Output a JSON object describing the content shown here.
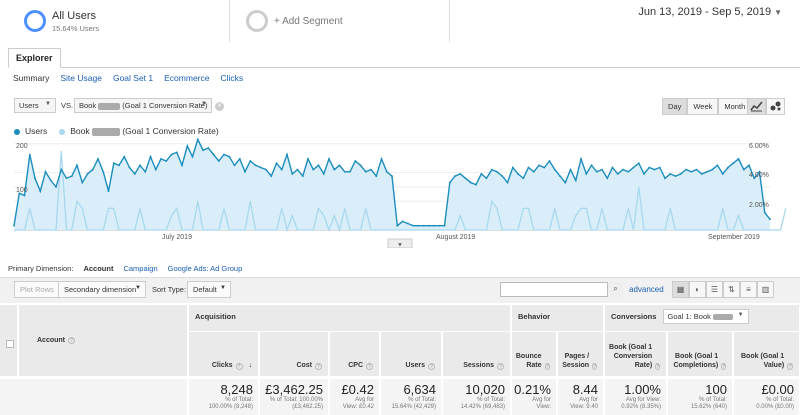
{
  "segments": {
    "primary": {
      "title": "All Users",
      "subtitle": "15.64% Users"
    },
    "add_label": "+ Add Segment"
  },
  "date_range": "Jun 13, 2019 - Sep 5, 2019",
  "explorer_tab": "Explorer",
  "subtabs": [
    "Summary",
    "Site Usage",
    "Goal Set 1",
    "Ecommerce",
    "Clicks"
  ],
  "metric1": "Users",
  "vs_label": "VS.",
  "metric2_prefix": "Book",
  "metric2_suffix": "(Goal 1 Conversion Rate)",
  "time_buttons": [
    "Day",
    "Week",
    "Month"
  ],
  "legend": {
    "series1": "Users",
    "series2_prefix": "Book",
    "series2_suffix": "(Goal 1 Conversion Rate)"
  },
  "colors": {
    "users": "#1c8dbd",
    "conv": "#a8d8ef",
    "fill": "#d9eef8"
  },
  "chart_data": {
    "type": "line",
    "x_labels": [
      "July 2019",
      "August 2019",
      "September 2019"
    ],
    "y_left_ticks": [
      "200",
      "100"
    ],
    "y_right_ticks": [
      "6.00%",
      "4.00%",
      "2.00%"
    ],
    "series": [
      {
        "name": "Users",
        "axis": "left",
        "values": [
          10,
          85,
          80,
          175,
          120,
          90,
          135,
          115,
          100,
          140,
          120,
          125,
          150,
          110,
          130,
          140,
          165,
          135,
          90,
          155,
          150,
          170,
          145,
          130,
          150,
          135,
          170,
          140,
          165,
          160,
          175,
          180,
          150,
          195,
          170,
          210,
          185,
          190,
          175,
          160,
          175,
          170,
          150,
          165,
          135,
          160,
          150,
          145,
          140,
          125,
          155,
          140,
          175,
          130,
          140,
          125,
          165,
          140,
          150,
          130,
          165,
          140,
          150,
          135,
          135,
          160,
          150,
          135,
          140,
          125,
          165,
          135,
          125,
          10,
          20,
          15,
          10,
          10,
          10,
          10,
          10,
          10,
          10,
          110,
          125,
          130,
          120,
          110,
          105,
          130,
          120,
          140,
          135,
          125,
          110,
          145,
          130,
          120,
          145,
          135,
          150,
          145,
          160,
          140,
          125,
          110,
          140,
          115,
          165,
          130,
          150,
          135,
          140,
          120,
          145,
          130,
          140,
          135,
          145,
          155,
          130,
          145,
          140,
          145,
          120,
          130,
          125,
          130,
          140,
          135,
          140,
          130,
          135,
          140,
          150,
          130,
          145,
          155,
          165,
          140,
          150,
          120,
          135,
          40,
          25
        ]
      },
      {
        "name": "Book (Goal 1 Conversion Rate)",
        "axis": "right",
        "values": [
          0,
          0,
          0,
          1.5,
          0,
          0,
          0,
          0,
          0,
          5.5,
          0,
          0,
          2.0,
          1.5,
          0,
          0,
          0,
          0,
          1.5,
          1.5,
          0,
          0,
          0,
          0,
          1.5,
          0,
          0,
          0,
          0,
          0,
          1.0,
          1.5,
          0,
          0,
          0,
          2.0,
          0,
          0,
          0,
          0,
          1.5,
          0,
          0,
          0,
          0,
          2.0,
          0,
          0,
          0,
          0,
          0,
          1.5,
          0,
          1.0,
          0,
          0,
          0,
          0,
          1.5,
          1.0,
          0,
          1.0,
          0,
          1.5,
          0,
          0,
          0,
          1.5,
          0,
          0,
          0,
          0,
          0,
          0,
          0,
          0,
          0,
          0,
          0,
          0,
          0,
          0,
          0,
          0,
          0,
          1.0,
          0,
          0,
          0,
          0,
          0,
          2.0,
          1.5,
          0,
          0,
          0,
          0,
          1.5,
          1.5,
          0,
          0,
          0,
          0,
          1.5,
          0,
          0,
          0,
          1.0,
          1.5,
          1.5,
          0,
          0,
          1.5,
          0,
          0,
          0,
          0,
          1.5,
          0,
          3.0,
          0,
          0,
          0,
          0,
          0,
          1.5,
          0,
          0,
          0,
          0,
          0,
          0,
          0,
          0,
          0,
          1.5,
          0,
          0,
          1.0,
          0,
          0,
          0,
          0,
          0,
          0,
          0,
          0,
          1.5
        ]
      }
    ]
  },
  "primary_dimension": {
    "label": "Primary Dimension:",
    "active": "Account",
    "options": [
      "Campaign",
      "Google Ads: Ad Group"
    ]
  },
  "controls": {
    "plot_rows": "Plot Rows",
    "secondary": "Secondary dimension",
    "sort_label": "Sort Type:",
    "sort_value": "Default",
    "advanced": "advanced"
  },
  "table": {
    "groups": {
      "acquisition": "Acquisition",
      "behavior": "Behavior",
      "conversions": "Conversions",
      "goal_select": "Goal 1: Book"
    },
    "account_header": "Account",
    "columns": [
      {
        "label": "Clicks",
        "total": "8,248",
        "sub1": "% of Total:",
        "sub2": "100.00% (8,248)"
      },
      {
        "label": "Cost",
        "total": "£3,462.25",
        "sub1": "% of Total: 100.00%",
        "sub2": "(£3,462.25)"
      },
      {
        "label": "CPC",
        "total": "£0.42",
        "sub1": "Avg for",
        "sub2": "View: £0.42"
      },
      {
        "label": "Users",
        "total": "6,634",
        "sub1": "% of Total:",
        "sub2": "15.64% (42,429)"
      },
      {
        "label": "Sessions",
        "total": "10,020",
        "sub1": "% of Total:",
        "sub2": "14.42% (69,483)"
      },
      {
        "label": "Bounce Rate",
        "total": "0.21%",
        "sub1": "Avg for",
        "sub2": "View:"
      },
      {
        "label": "Pages / Session",
        "total": "8.44",
        "sub1": "Avg for",
        "sub2": "View: 9.40"
      },
      {
        "label": "Book (Goal 1 Conversion Rate)",
        "total": "1.00%",
        "sub1": "Avg for View:",
        "sub2": "0.92% (8.35%)"
      },
      {
        "label": "Book (Goal 1 Completions)",
        "total": "100",
        "sub1": "% of Total:",
        "sub2": "15.62% (640)"
      },
      {
        "label": "Book (Goal 1 Value)",
        "total": "£0.00",
        "sub1": "% of Total:",
        "sub2": "0.00% (£0.00)"
      }
    ]
  }
}
